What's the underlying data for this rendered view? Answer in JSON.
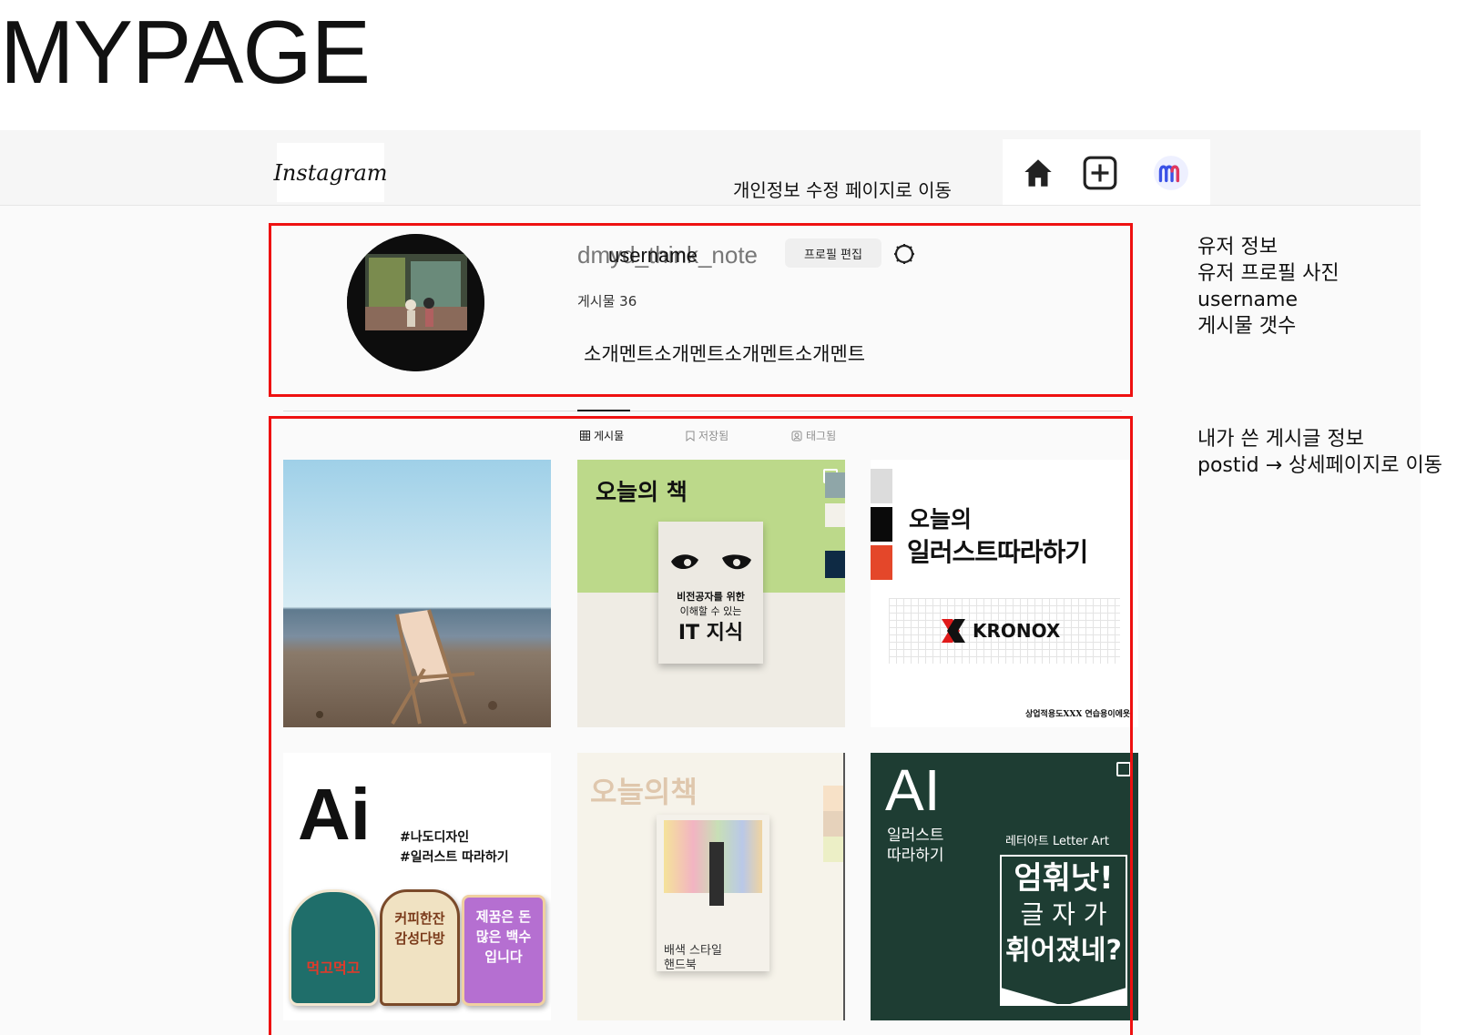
{
  "page_title": "MYPAGE",
  "header": {
    "logo": "Instagram",
    "nav_hint": "개인정보 수정 페이지로 이동",
    "nav_icons": [
      "home-icon",
      "add-post-icon",
      "profile-m-icon"
    ]
  },
  "profile": {
    "username": "dmyd_think_note",
    "username_placeholder": "username",
    "edit_button": "프로필 편집",
    "post_count_label": "게시물 36",
    "bio": "소개멘트소개멘트소개멘트소개멘트"
  },
  "tabs": [
    {
      "icon": "grid-icon",
      "label": "게시물",
      "active": true
    },
    {
      "icon": "bookmark-icon",
      "label": "저장됨",
      "active": false
    },
    {
      "icon": "tag-icon",
      "label": "태그됨",
      "active": false
    }
  ],
  "posts": {
    "tile2": {
      "title": "오늘의 책",
      "book_line1": "비전공자를 위한",
      "book_line2": "이해할 수 있는",
      "book_big": "IT 지식"
    },
    "tile3": {
      "line1": "오늘의",
      "line2": "일러스트따라하기",
      "brand": "KRONOX",
      "footer": "상업적용도XXX 연습용이에욧!"
    },
    "tile4": {
      "big": "Ai",
      "tag1": "#나도디자인",
      "tag2": "#일러스트 따라하기",
      "sticker1": "먹고먹고",
      "sticker2": "커피한잔 감성다방",
      "sticker3": "제꿈은 돈많은 백수입니다"
    },
    "tile5": {
      "title": "오늘의책",
      "book_line1": "배색 스타일",
      "book_line2": "핸드북"
    },
    "tile6": {
      "big": "AI",
      "sub1": "일러스트",
      "sub2": "따라하기",
      "caption": "레터아트 Letter Art",
      "art1": "엄훠낫!",
      "art2": "글 자 가",
      "art3": "휘어졌네?"
    }
  },
  "annotations": {
    "profile": [
      "유저 정보",
      "유저 프로필 사진",
      "username",
      "게시물 갯수"
    ],
    "posts": [
      "내가 쓴 게시글 정보",
      "postid → 상세페이지로 이동"
    ]
  },
  "colors": {
    "highlight_red": "#ee1111",
    "tile6_bg": "#1e3d33",
    "tile2_green": "#bcd98a"
  }
}
